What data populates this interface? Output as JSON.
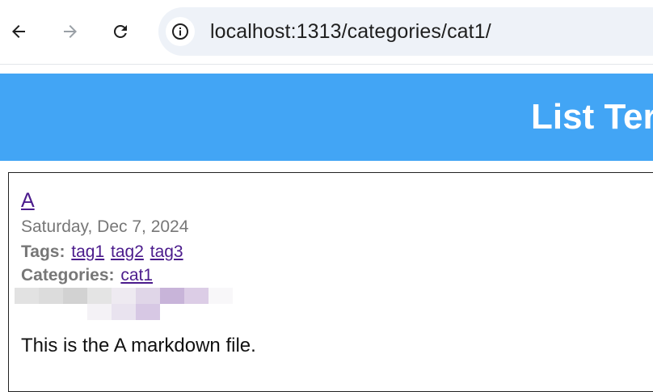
{
  "browser": {
    "url": "localhost:1313/categories/cat1/",
    "icons": {
      "back": "arrow-left-icon",
      "forward": "arrow-right-icon",
      "reload": "reload-icon",
      "site_info": "info-circle-icon"
    }
  },
  "page": {
    "title": "List Ter",
    "header_color": "#42a5f5",
    "post": {
      "title": "A",
      "date": "Saturday, Dec 7, 2024",
      "tags_label": "Tags:",
      "tags": [
        "tag1",
        "tag2",
        "tag3"
      ],
      "categories_label": "Categories:",
      "categories": [
        "cat1"
      ],
      "body": "This is the A markdown file."
    }
  }
}
